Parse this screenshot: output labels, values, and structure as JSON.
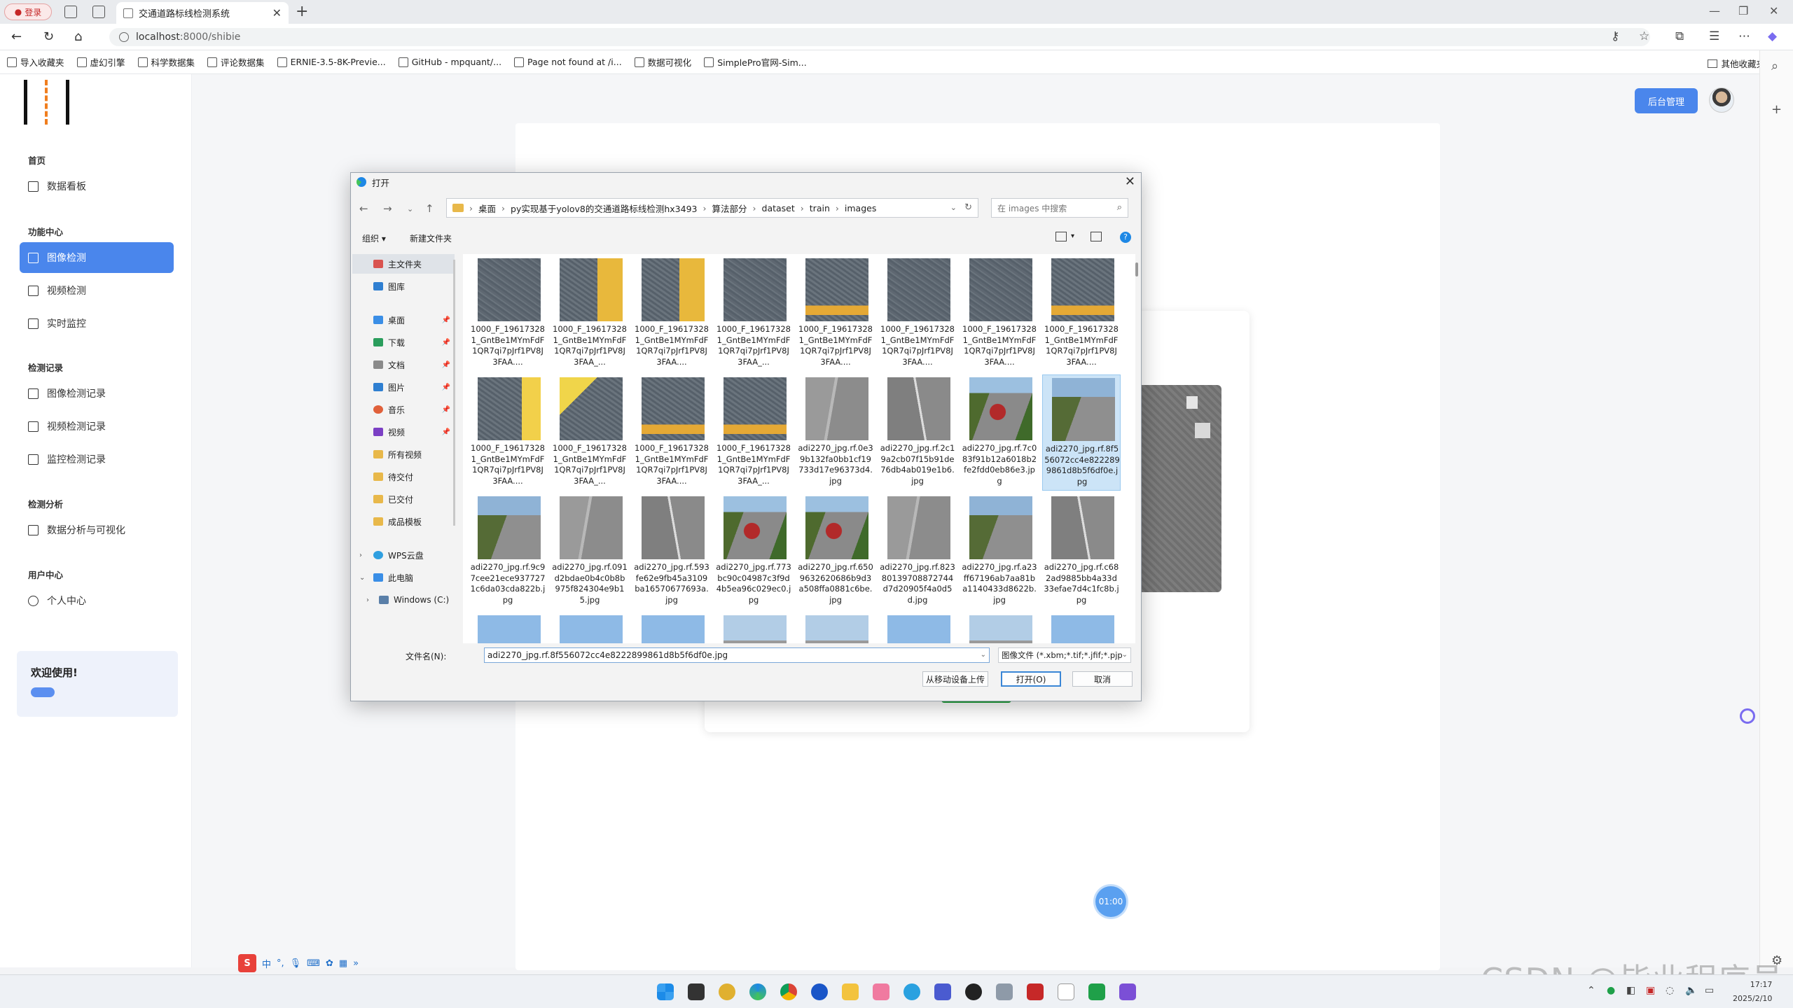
{
  "browser": {
    "profile_label": "登录",
    "tab_title": "交通道路标线检测系统",
    "url_host": "localhost",
    "url_path": ":8000/shibie",
    "bookmarks": [
      "导入收藏夹",
      "虚幻引擎",
      "科学数据集",
      "评论数据集",
      "ERNIE-3.5-8K-Previe...",
      "GitHub - mpquant/...",
      "Page not found at /i...",
      "数据可视化",
      "SimplePro官网-Sim..."
    ],
    "other_bookmarks": "其他收藏夹"
  },
  "sidebar": {
    "sections": [
      {
        "title": "首页",
        "items": [
          "数据看板"
        ]
      },
      {
        "title": "功能中心",
        "items": [
          "图像检测",
          "视频检测",
          "实时监控"
        ]
      },
      {
        "title": "检测记录",
        "items": [
          "图像检测记录",
          "视频检测记录",
          "监控检测记录"
        ]
      },
      {
        "title": "检测分析",
        "items": [
          "数据分析与可视化"
        ]
      },
      {
        "title": "用户中心",
        "items": [
          "个人中心"
        ]
      }
    ],
    "active_item": "图像检测",
    "welcome": "欢迎使用!"
  },
  "header": {
    "admin_button": "后台管理"
  },
  "timer": "01:00",
  "dialog": {
    "title": "打开",
    "breadcrumb": [
      "桌面",
      "py实现基于yolov8的交通道路标线检测hx3493",
      "算法部分",
      "dataset",
      "train",
      "images"
    ],
    "search_placeholder": "在 images 中搜索",
    "toolbar": {
      "organize": "组织 ▾",
      "new_folder": "新建文件夹"
    },
    "nav": [
      {
        "label": "主文件夹",
        "color": "#d9534f"
      },
      {
        "label": "图库",
        "color": "#2f7fd1"
      },
      {
        "label": "桌面",
        "color": "#3a8ee6",
        "pin": true
      },
      {
        "label": "下载",
        "color": "#2a9d5c",
        "pin": true
      },
      {
        "label": "文档",
        "color": "#8a8a8a",
        "pin": true
      },
      {
        "label": "图片",
        "color": "#2f7fd1",
        "pin": true
      },
      {
        "label": "音乐",
        "color": "#e0603a",
        "pin": true
      },
      {
        "label": "视频",
        "color": "#7b3fc4",
        "pin": true
      },
      {
        "label": "所有视频",
        "color": "#e8b84a"
      },
      {
        "label": "待交付",
        "color": "#e8b84a"
      },
      {
        "label": "已交付",
        "color": "#e8b84a"
      },
      {
        "label": "成品模板",
        "color": "#e8b84a"
      },
      {
        "label": "WPS云盘",
        "color": "#2f9fe0"
      },
      {
        "label": "此电脑",
        "color": "#3a8ee6"
      },
      {
        "label": "Windows (C:)",
        "color": "#5a7fa8"
      }
    ],
    "files": [
      {
        "name": "1000_F_196173281_GntBe1MYmFdF1QR7qi7pJrf1PV8J3FAA....",
        "thumb": "t-asph"
      },
      {
        "name": "1000_F_196173281_GntBe1MYmFdF1QR7qi7pJrf1PV8J3FAA_...",
        "thumb": "t-asph-y"
      },
      {
        "name": "1000_F_196173281_GntBe1MYmFdF1QR7qi7pJrf1PV8J3FAA....",
        "thumb": "t-asph-y"
      },
      {
        "name": "1000_F_196173281_GntBe1MYmFdF1QR7qi7pJrf1PV8J3FAA_...",
        "thumb": "t-asph"
      },
      {
        "name": "1000_F_196173281_GntBe1MYmFdF1QR7qi7pJrf1PV8J3FAA....",
        "thumb": "t-asph-yb"
      },
      {
        "name": "1000_F_196173281_GntBe1MYmFdF1QR7qi7pJrf1PV8J3FAA....",
        "thumb": "t-asph"
      },
      {
        "name": "1000_F_196173281_GntBe1MYmFdF1QR7qi7pJrf1PV8J3FAA....",
        "thumb": "t-asph"
      },
      {
        "name": "1000_F_196173281_GntBe1MYmFdF1QR7qi7pJrf1PV8J3FAA....",
        "thumb": "t-asph-yb"
      },
      {
        "name": "1000_F_196173281_GntBe1MYmFdF1QR7qi7pJrf1PV8J3FAA....",
        "thumb": "t-asph-y2"
      },
      {
        "name": "1000_F_196173281_GntBe1MYmFdF1QR7qi7pJrf1PV8J3FAA_...",
        "thumb": "t-ylow"
      },
      {
        "name": "1000_F_196173281_GntBe1MYmFdF1QR7qi7pJrf1PV8J3FAA....",
        "thumb": "t-asph-yb"
      },
      {
        "name": "1000_F_196173281_GntBe1MYmFdF1QR7qi7pJrf1PV8J3FAA_...",
        "thumb": "t-asph-yb"
      },
      {
        "name": "adi2270_jpg.rf.0e39b132fa0bb1cf19733d17e96373d4.jpg",
        "thumb": "t-road"
      },
      {
        "name": "adi2270_jpg.rf.2c19a2cb07f15b91de76db4ab019e1b6.jpg",
        "thumb": "t-road2"
      },
      {
        "name": "adi2270_jpg.rf.7c083f91b12a6018b2fe2fdd0eb86e3.jpg",
        "thumb": "t-bus"
      },
      {
        "name": "adi2270_jpg.rf.8f556072cc4e8222899861d8b5f6df0e.jpg",
        "thumb": "t-hedge",
        "selected": true
      },
      {
        "name": "adi2270_jpg.rf.9c97cee21ece9377271c6da03cda822b.jpg",
        "thumb": "t-hedge"
      },
      {
        "name": "adi2270_jpg.rf.091d2bdae0b4c0b8b975f824304e9b15.jpg",
        "thumb": "t-road"
      },
      {
        "name": "adi2270_jpg.rf.593fe62e9fb45a3109ba16570677693a.jpg",
        "thumb": "t-road2"
      },
      {
        "name": "adi2270_jpg.rf.773bc90c04987c3f9d4b5ea96c029ec0.jpg",
        "thumb": "t-bus"
      },
      {
        "name": "adi2270_jpg.rf.6509632620686b9d3a508ffa0881c6be.jpg",
        "thumb": "t-bus"
      },
      {
        "name": "adi2270_jpg.rf.82380139708872744d7d20905f4a0d5d.jpg",
        "thumb": "t-road"
      },
      {
        "name": "adi2270_jpg.rf.a23ff67196ab7aa81ba1140433d8622b.jpg",
        "thumb": "t-hedge"
      },
      {
        "name": "adi2270_jpg.rf.c682ad9885bb4a33d33efae7d4c1fc8b.jpg",
        "thumb": "t-road2"
      },
      {
        "name": "",
        "thumb": "t-sky"
      },
      {
        "name": "",
        "thumb": "t-sky"
      },
      {
        "name": "",
        "thumb": "t-sky"
      },
      {
        "name": "",
        "thumb": "t-road3"
      },
      {
        "name": "",
        "thumb": "t-road3"
      },
      {
        "name": "",
        "thumb": "t-sky"
      },
      {
        "name": "",
        "thumb": "t-road3"
      },
      {
        "name": "",
        "thumb": "t-sky"
      }
    ],
    "filename_label": "文件名(N):",
    "filename_value": "adi2270_jpg.rf.8f556072cc4e8222899861d8b5f6df0e.jpg",
    "filetype_value": "图像文件 (*.xbm;*.tif;*.jfif;*.pjp",
    "btn_mobile": "从移动设备上传",
    "btn_open": "打开(O)",
    "btn_cancel": "取消"
  },
  "ime": {
    "zh": "中"
  },
  "taskbar": {
    "time": "17:17",
    "date": "2025/2/10"
  },
  "watermark": "CSDN @毕业程序员",
  "colors": {
    "accent": "#4a86ec",
    "selected_file_bg": "#cce4f7",
    "green_button": "#21a33d"
  }
}
